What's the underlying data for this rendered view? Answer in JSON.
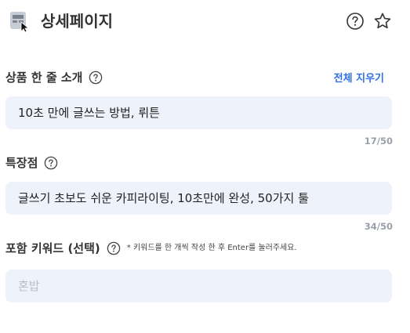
{
  "header": {
    "title": "상세페이지",
    "icons": {
      "app": "detail-page-icon",
      "help": "question-circle-icon",
      "favorite": "star-outline-icon"
    }
  },
  "one_line_intro": {
    "label": "상품 한 줄 소개",
    "clear_label": "전체 지우기",
    "value": "10초 만에 글쓰는 방법, 뤼튼",
    "counter": "17/50"
  },
  "features": {
    "label": "특장점",
    "value": "글쓰기 초보도 쉬운 카피라이팅, 10초만에 완성, 50가지 툴",
    "counter": "34/50"
  },
  "keywords": {
    "label": "포함 키워드 (선택)",
    "note": "* 키워드를 한 개씩 작성 한 후 Enter를 눌러주세요.",
    "placeholder": "혼밥"
  },
  "colors": {
    "accent": "#2f6fe4",
    "field_bg": "#eef3fb",
    "muted": "#9aa0a8"
  }
}
